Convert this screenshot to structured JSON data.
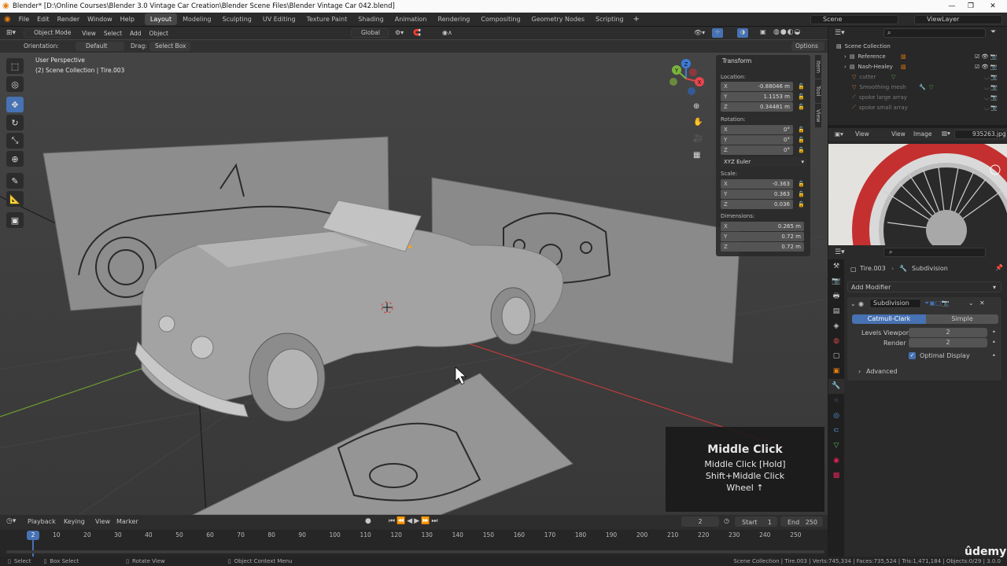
{
  "window": {
    "title": "Blender* [D:\\Online Courses\\Blender 3.0 Vintage Car Creation\\Blender Scene Files\\Blender Vintage Car 042.blend]",
    "min": "—",
    "max": "❐",
    "close": "✕"
  },
  "menus": [
    "File",
    "Edit",
    "Render",
    "Window",
    "Help"
  ],
  "workspaces": [
    "Layout",
    "Modeling",
    "Sculpting",
    "UV Editing",
    "Texture Paint",
    "Shading",
    "Animation",
    "Rendering",
    "Compositing",
    "Geometry Nodes",
    "Scripting"
  ],
  "workspace_add": "+",
  "scene": {
    "name": "Scene",
    "viewlayer": "ViewLayer"
  },
  "viewport_header": {
    "mode": "Object Mode",
    "menus": [
      "View",
      "Select",
      "Add",
      "Object"
    ],
    "transform": "Global"
  },
  "subheader": {
    "orientation_label": "Orientation:",
    "orientation": "Default",
    "drag_label": "Drag:",
    "drag": "Select Box",
    "options": "Options"
  },
  "overlay_text": {
    "line1": "User Perspective",
    "line2": "(2) Scene Collection | Tire.003"
  },
  "gizmo": {
    "x": "X",
    "y": "Y",
    "z": "Z"
  },
  "npanel": {
    "title": "Transform",
    "location_label": "Location:",
    "location": [
      {
        "k": "X",
        "v": "-0.88046 m"
      },
      {
        "k": "Y",
        "v": "1.1153 m"
      },
      {
        "k": "Z",
        "v": "0.34481 m"
      }
    ],
    "rotation_label": "Rotation:",
    "rotation": [
      {
        "k": "X",
        "v": "0°"
      },
      {
        "k": "Y",
        "v": "0°"
      },
      {
        "k": "Z",
        "v": "0°"
      }
    ],
    "rotation_mode": "XYZ Euler",
    "scale_label": "Scale:",
    "scale": [
      {
        "k": "X",
        "v": "-0.363"
      },
      {
        "k": "Y",
        "v": "0.363"
      },
      {
        "k": "Z",
        "v": "0.036"
      }
    ],
    "dimensions_label": "Dimensions:",
    "dimensions": [
      {
        "k": "X",
        "v": "0.265 m"
      },
      {
        "k": "Y",
        "v": "0.72 m"
      },
      {
        "k": "Z",
        "v": "0.72 m"
      }
    ],
    "tabs": [
      "Item",
      "Tool",
      "View"
    ]
  },
  "outliner": {
    "root": "Scene Collection",
    "items": [
      {
        "name": "Reference",
        "dim": false
      },
      {
        "name": "Nash-Healey",
        "dim": false
      },
      {
        "name": "cutter",
        "dim": true
      },
      {
        "name": "Smoothing mesh",
        "dim": true
      },
      {
        "name": "spoke large array",
        "dim": true
      },
      {
        "name": "spoke small array",
        "dim": true
      }
    ]
  },
  "image_editor": {
    "menus": [
      "View",
      "View",
      "Image"
    ],
    "image": "935263.jpg"
  },
  "properties": {
    "object": "Tire.003",
    "modifier_crumb": "Subdivision",
    "add_modifier": "Add Modifier",
    "modifier_name": "Subdivision",
    "mode_a": "Catmull-Clark",
    "mode_b": "Simple",
    "levels_label": "Levels Viewport",
    "levels": "2",
    "render_label": "Render",
    "render": "2",
    "optimal": "Optimal Display",
    "advanced": "Advanced"
  },
  "tooltip": {
    "title": "Middle Click",
    "l1": "Middle Click [Hold]",
    "l2": "Shift+Middle Click",
    "l3": "Wheel ↑"
  },
  "timeline": {
    "menus": [
      "Playback",
      "Keying",
      "View",
      "Marker"
    ],
    "current": "2",
    "start_label": "Start",
    "start": "1",
    "end_label": "End",
    "end": "250",
    "ticks": [
      "10",
      "20",
      "30",
      "40",
      "50",
      "60",
      "70",
      "80",
      "90",
      "100",
      "110",
      "120",
      "130",
      "140",
      "150",
      "160",
      "170",
      "180",
      "190",
      "200",
      "210",
      "220",
      "230",
      "240",
      "250"
    ],
    "playhead": "2"
  },
  "statusbar": {
    "select": "Select",
    "box": "Box Select",
    "rotate": "Rotate View",
    "context": "Object Context Menu",
    "stats": "Scene Collection | Tire.003 | Verts:745,334 | Faces:735,524 | Tris:1,471,184 | Objects:0/29 | 3.0.0"
  },
  "watermark": "ûdemy",
  "colors": {
    "accent": "#4772b3",
    "axis_x": "#e8454d",
    "axis_y": "#7ab33c",
    "axis_z": "#3d7bd6",
    "active_ws": "#474747"
  }
}
